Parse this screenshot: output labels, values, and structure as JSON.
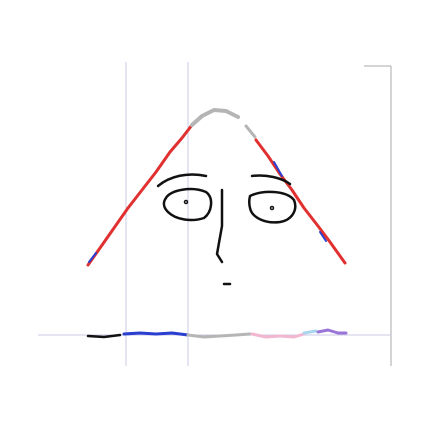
{
  "canvas": {
    "background": "#ffffff",
    "guide_color": "#c8c8e6",
    "frame_color": "#a8a8a8",
    "ink_colors": {
      "red": "#e03030",
      "gray": "#b5b5b5",
      "black": "#111111",
      "blue": "#2a3fd0",
      "pink": "#f2b6d0",
      "purple": "#9a74d8",
      "light_blue": "#a9d6ee"
    }
  },
  "sketch": {
    "subject": "triangle-face-doodle",
    "tools": [
      "pen"
    ]
  }
}
